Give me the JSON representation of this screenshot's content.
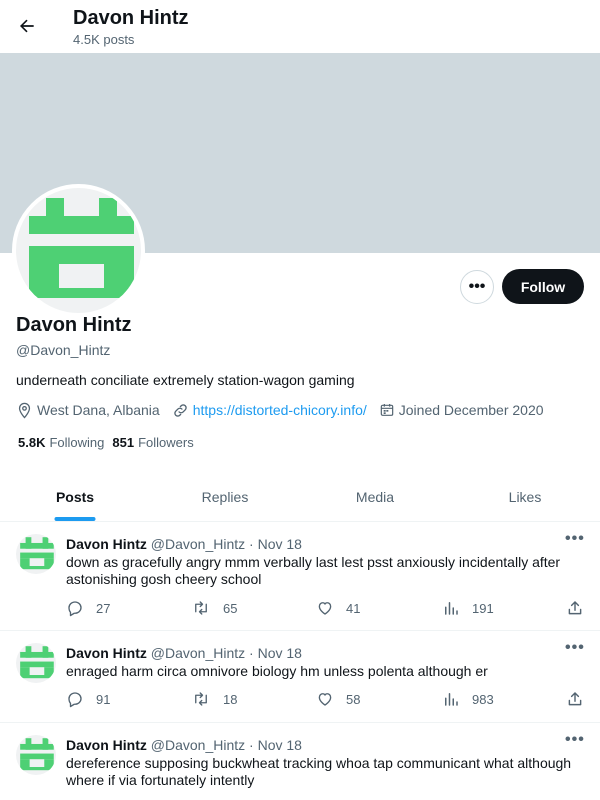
{
  "header": {
    "title": "Davon Hintz",
    "post_count": "4.5K posts"
  },
  "profile": {
    "name": "Davon Hintz",
    "handle": "@Davon_Hintz",
    "bio": "underneath conciliate extremely station-wagon gaming",
    "location": "West Dana, Albania",
    "website": "https://distorted-chicory.info/",
    "joined": "Joined December 2020",
    "following_count": "5.8K",
    "following_label": "Following",
    "followers_count": "851",
    "followers_label": "Followers",
    "follow_label": "Follow",
    "more_label": "•••"
  },
  "tabs": [
    {
      "label": "Posts",
      "active": true
    },
    {
      "label": "Replies",
      "active": false
    },
    {
      "label": "Media",
      "active": false
    },
    {
      "label": "Likes",
      "active": false
    }
  ],
  "posts": [
    {
      "name": "Davon Hintz",
      "meta": "@Davon_Hintz · Nov 18",
      "text": "down as gracefully angry mmm verbally last lest psst anxiously incidentally after astonishing gosh cheery school",
      "replies": "27",
      "reposts": "65",
      "likes": "41",
      "views": "191"
    },
    {
      "name": "Davon Hintz",
      "meta": "@Davon_Hintz · Nov 18",
      "text": "enraged harm circa omnivore biology hm unless polenta although er",
      "replies": "91",
      "reposts": "18",
      "likes": "58",
      "views": "983"
    },
    {
      "name": "Davon Hintz",
      "meta": "@Davon_Hintz · Nov 18",
      "text": "dereference supposing buckwheat tracking whoa tap communicant what although where if via fortunately intently",
      "replies": "",
      "reposts": "",
      "likes": "",
      "views": ""
    }
  ],
  "post_more_label": "•••",
  "colors": {
    "banner": "#cfd9de",
    "avatar_green": "#4ed074",
    "accent": "#1d9bf0",
    "follow_bg": "#0f1419"
  },
  "icons": {
    "back": "arrow-left-icon",
    "location": "location-pin-icon",
    "link": "link-icon",
    "calendar": "calendar-icon",
    "reply": "reply-icon",
    "repost": "repost-icon",
    "like": "heart-icon",
    "views": "views-icon",
    "share": "share-icon"
  }
}
